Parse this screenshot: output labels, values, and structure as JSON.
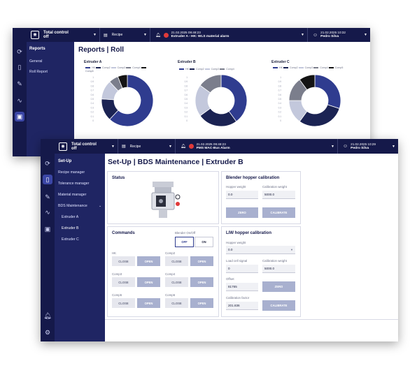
{
  "reports_window": {
    "topbar": {
      "machine_label": "Total control off",
      "recipe_label": "Recipe",
      "alarm_time": "21.02.2025 09:48:23",
      "alarm_text": "Extruder A - HK: WLS material alarm",
      "user_time": "21.02.2025 10:32",
      "user_name": "Pedro Silva"
    },
    "nav": {
      "title": "Reports",
      "items": [
        "General",
        "Roll Report"
      ]
    },
    "page_title": "Reports |  Roll",
    "charts": [
      {
        "title": "Extruder A",
        "legend": [
          "HK",
          "Comp2",
          "Comp3",
          "Comp4",
          "Comp5"
        ]
      },
      {
        "title": "Extruder B",
        "legend": [
          "HK",
          "Comp2",
          "Comp3",
          "Comp4"
        ]
      },
      {
        "title": "Extruder C",
        "legend": [
          "HK",
          "Comp2",
          "Comp3",
          "Comp4",
          "Comp5"
        ]
      }
    ],
    "yticks": [
      "1",
      "0.9",
      "0.8",
      "0.7",
      "0.6",
      "0.5",
      "0.4",
      "0.3",
      "0.2",
      "0.1",
      "0"
    ]
  },
  "chart_data": [
    {
      "type": "pie",
      "title": "Extruder A",
      "categories": [
        "HK",
        "Comp2",
        "Comp3",
        "Comp4",
        "Comp5"
      ],
      "values": [
        62,
        14,
        12,
        6,
        6
      ]
    },
    {
      "type": "pie",
      "title": "Extruder B",
      "categories": [
        "HK",
        "Comp2",
        "Comp3",
        "Comp4"
      ],
      "values": [
        40,
        25,
        20,
        15
      ]
    },
    {
      "type": "pie",
      "title": "Extruder C",
      "categories": [
        "HK",
        "Comp2",
        "Comp3",
        "Comp4",
        "Comp5"
      ],
      "values": [
        30,
        30,
        15,
        15,
        10
      ]
    }
  ],
  "series_colors": [
    "#2f3c8f",
    "#1b2353",
    "#c3c8dc",
    "#7b7e8c",
    "#141414"
  ],
  "setup_window": {
    "topbar": {
      "machine_label": "Total control off",
      "recipe_label": "Recipe",
      "alarm_time": "21.02.2025 09:48:23",
      "alarm_text": "PMS MAC-Bus Alarm",
      "user_time": "21.02.2025 10:29",
      "user_name": "Pedro Silva"
    },
    "nav": {
      "title": "Set-Up",
      "items": [
        "Recipe manager",
        "Tolerance manager",
        "Material manager",
        "BDS Maintenance"
      ],
      "subitems": [
        "Extruder A",
        "Extruder B",
        "Extruder C"
      ]
    },
    "page_title": "Set-Up | BDS Maintenance | Extruder B",
    "status": {
      "title": "Status"
    },
    "commands": {
      "title": "Commands",
      "blender_label": "Blender On/Off",
      "off_label": "OFF",
      "on_label": "ON",
      "rows": [
        {
          "name": "HK",
          "close": "CLOSE",
          "open": "OPEN"
        },
        {
          "name": "Comp2",
          "close": "CLOSE",
          "open": "OPEN"
        },
        {
          "name": "Comp3",
          "close": "CLOSE",
          "open": "OPEN"
        },
        {
          "name": "Comp4",
          "close": "CLOSE",
          "open": "OPEN"
        },
        {
          "name": "Comp5",
          "close": "CLOSE",
          "open": "OPEN"
        },
        {
          "name": "Comp6",
          "close": "CLOSE",
          "open": "OPEN"
        }
      ]
    },
    "blender_cal": {
      "title": "Blender hopper calibration",
      "hopper_weight_label": "Hopper weight",
      "hopper_weight_value": "0.0",
      "cal_weight_label": "Calibration weight",
      "cal_weight_value": "5000.0",
      "zero_label": "ZERO",
      "calibrate_label": "CALIBRATE"
    },
    "liw_cal": {
      "title": "LIW hopper calibration",
      "hopper_weight_label": "Hopper weight",
      "hopper_weight_value": "0.0",
      "load_cell_label": "Load cell signal",
      "load_cell_value": "0",
      "cal_weight_label": "Calibration weight",
      "cal_weight_value": "5000.0",
      "offset_label": "Offset",
      "offset_value": "81765",
      "zero_label": "ZERO",
      "cal_factor_label": "Calibration factor",
      "cal_factor_value": "201.836",
      "calibrate_label": "CALIBRATE"
    }
  }
}
